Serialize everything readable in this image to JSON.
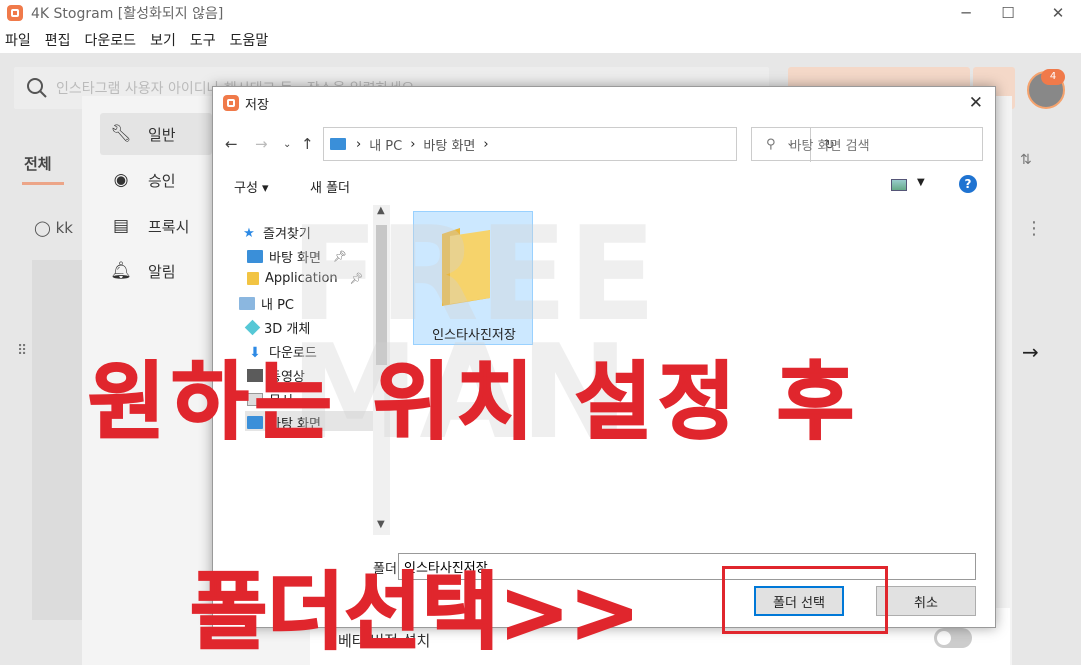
{
  "app": {
    "title": "4K Stogram [활성화되지 않음]",
    "menu": [
      "파일",
      "편집",
      "다운로드",
      "보기",
      "도구",
      "도움말"
    ],
    "search_placeholder": "인스타그램 사용자 아이디나 해시태그 등 - 장소을 입력하세요",
    "avatar_badge": "4",
    "tab_all": "전체",
    "user_prefix": "kk",
    "colors": {
      "accent": "#f07a4a",
      "annotation": "#e0262d"
    }
  },
  "settings": {
    "items": [
      {
        "label": "일반",
        "icon": "wrench-icon"
      },
      {
        "label": "승인",
        "icon": "user-circle-icon"
      },
      {
        "label": "프록시",
        "icon": "server-icon"
      },
      {
        "label": "알림",
        "icon": "bell-icon"
      }
    ],
    "beta_label": "베타 버전 설치"
  },
  "dialog": {
    "title": "저장",
    "breadcrumb": [
      "내 PC",
      "바탕 화면"
    ],
    "search_placeholder": "바탕 화면 검색",
    "organize": "구성 ▾",
    "new_folder": "새 폴더",
    "tree": [
      {
        "label": "즐겨찾기",
        "icon": "star-icon",
        "pinned": false
      },
      {
        "label": "바탕 화면",
        "icon": "desktop-icon",
        "pinned": true
      },
      {
        "label": "Application",
        "icon": "folder-icon",
        "pinned": true
      },
      {
        "label": "내 PC",
        "icon": "pc-icon",
        "pinned": false
      },
      {
        "label": "3D 개체",
        "icon": "3d-icon",
        "pinned": false
      },
      {
        "label": "다운로드",
        "icon": "download-icon",
        "pinned": false
      },
      {
        "label": "동영상",
        "icon": "video-icon",
        "pinned": false
      },
      {
        "label": "문서",
        "icon": "document-icon",
        "pinned": false
      },
      {
        "label": "바탕 화면",
        "icon": "desktop-icon",
        "pinned": false
      }
    ],
    "folder_item": "인스타사진저장",
    "folder_field_label": "폴더:",
    "folder_field_value": "인스타사진저장",
    "select_button": "폴더 선택",
    "cancel_button": "취소"
  },
  "overlay": {
    "line1": "원하는 위치 설정 후",
    "line2": "폴더선택>>",
    "watermark": [
      "FREE",
      "MAN"
    ]
  }
}
